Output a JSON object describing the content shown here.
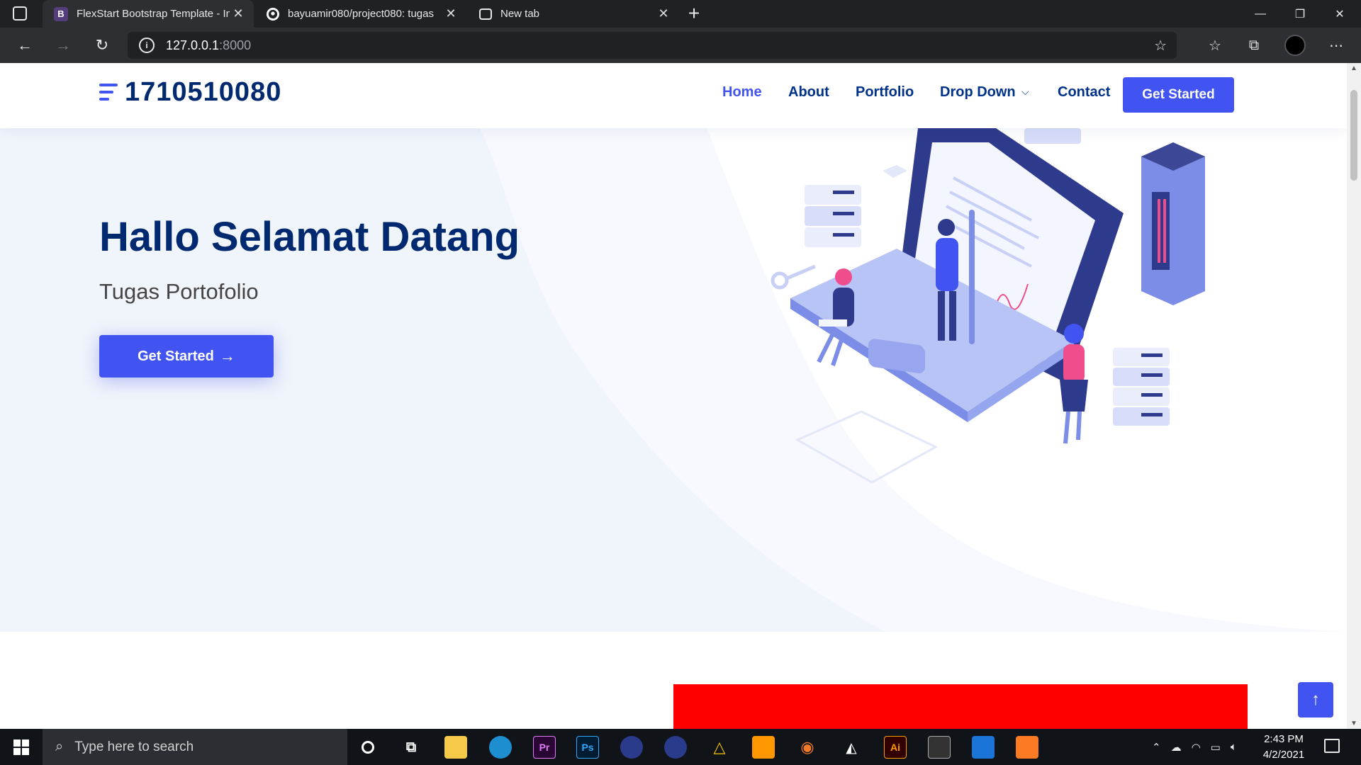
{
  "browser": {
    "tabs": [
      {
        "title": "FlexStart Bootstrap Template - In",
        "favicon": "B",
        "active": true
      },
      {
        "title": "bayuamir080/project080: tugas",
        "favicon": "github-icon",
        "active": false
      },
      {
        "title": "New tab",
        "favicon": "new-tab-icon",
        "active": false
      }
    ],
    "new_tab_label": "+",
    "url_host": "127.0.0.1",
    "url_port": ":8000"
  },
  "site": {
    "logo_text": "1710510080",
    "nav": [
      {
        "label": "Home",
        "active": true
      },
      {
        "label": "About"
      },
      {
        "label": "Portfolio"
      },
      {
        "label": "Drop Down",
        "has_dropdown": true
      },
      {
        "label": "Contact"
      }
    ],
    "header_button": "Get Started",
    "hero": {
      "title": "Hallo Selamat Datang",
      "subtitle": "Tugas Portofolio",
      "button": "Get Started",
      "button_icon": "arrow-right-icon"
    },
    "back_to_top_icon": "arrow-up-icon",
    "colors": {
      "primary": "#4154f1",
      "navy": "#012970",
      "hero_bg": "#f0f4fb",
      "red_block": "#ff0000"
    }
  },
  "taskbar": {
    "search_placeholder": "Type here to search",
    "apps": [
      "cortana-icon",
      "task-view-icon",
      "file-explorer-icon",
      "edge-icon",
      "Pr",
      "Ps",
      "cinema4d-icon",
      "cinema4d-icon",
      "autodesk-icon",
      "sublime-text-icon",
      "blender-icon",
      "unity-icon",
      "Ai",
      "terminal-icon",
      "media-player-icon",
      "xampp-icon"
    ],
    "time": "2:43 PM",
    "date": "4/2/2021"
  }
}
